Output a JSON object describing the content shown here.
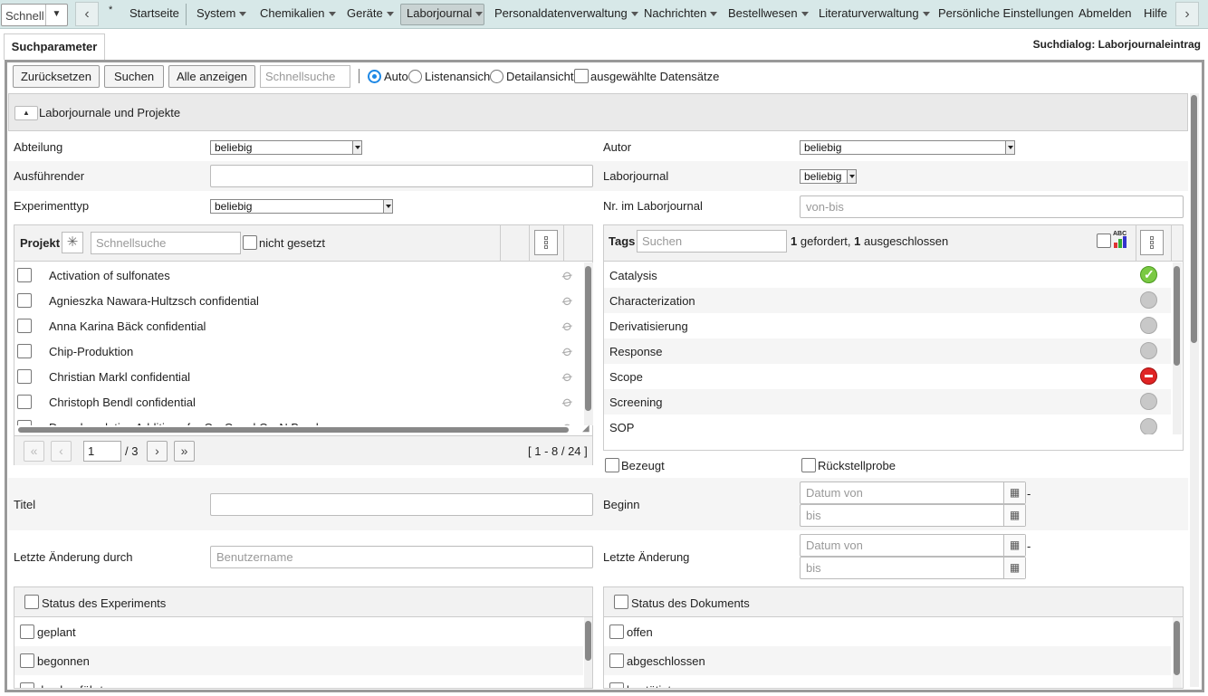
{
  "nav": {
    "quick_value": "Schnell",
    "items": [
      "*",
      "Startseite",
      "System",
      "Chemikalien",
      "Geräte",
      "Laborjournal",
      "Personaldatenverwaltung",
      "Nachrichten",
      "Bestellwesen",
      "Literaturverwaltung",
      "Persönliche Einstellungen",
      "Abmelden",
      "Hilfe"
    ],
    "active": "Laborjournal"
  },
  "tabs": {
    "active": "Suchparameter"
  },
  "dialog_title": "Suchdialog: Laborjournaleintrag",
  "toolbar": {
    "reset_label": "Zurücksetzen",
    "search_label": "Suchen",
    "show_all_label": "Alle anzeigen",
    "quick_search_placeholder": "Schnellsuche",
    "views": [
      "Auto",
      "Listenansicht",
      "Detailansicht"
    ],
    "selected_view": "Auto",
    "selected_records_label": "ausgewählte Datensätze"
  },
  "section": {
    "title": "Laborjournale und Projekte"
  },
  "form": {
    "abteilung_label": "Abteilung",
    "abteilung_value": "beliebig",
    "autor_label": "Autor",
    "autor_value": "beliebig",
    "ausfuehrender_label": "Ausführender",
    "laborjournal_label": "Laborjournal",
    "laborjournal_value": "beliebig",
    "experimenttyp_label": "Experimenttyp",
    "experimenttyp_value": "beliebig",
    "nr_label": "Nr. im Laborjournal",
    "nr_placeholder": "von-bis",
    "bezeugt_label": "Bezeugt",
    "rueckstellprobe_label": "Rückstellprobe",
    "titel_label": "Titel",
    "beginn_label": "Beginn",
    "date_from_placeholder": "Datum von",
    "date_to_placeholder": "bis",
    "date_dash": "-",
    "letzte_aenderung_durch_label": "Letzte Änderung durch",
    "username_placeholder": "Benutzername",
    "letzte_aenderung_label": "Letzte Änderung"
  },
  "projekt": {
    "title": "Projekt",
    "search_placeholder": "Schnellsuche",
    "not_set_label": "nicht gesetzt",
    "items": [
      "Activation of sulfonates",
      "Agnieszka Nawara-Hultzsch confidential",
      "Anna Karina Bäck confidential",
      "Chip-Produktion",
      "Christian Markl confidential",
      "Christoph Bendl confidential",
      "Decarboxylative Additions for C—C and C—N Bond..."
    ],
    "page": "1",
    "page_total": "/ 3",
    "range": "[ 1 - 8 / 24 ]"
  },
  "tags": {
    "title": "Tags",
    "search_placeholder": "Suchen",
    "required_count": "1",
    "required_text": "gefordert,",
    "excluded_count": "1",
    "excluded_text": "ausgeschlossen",
    "abc_label": "ABC",
    "items": [
      {
        "name": "Catalysis",
        "state": "required"
      },
      {
        "name": "Characterization",
        "state": "neutral"
      },
      {
        "name": "Derivatisierung",
        "state": "neutral"
      },
      {
        "name": "Response",
        "state": "neutral"
      },
      {
        "name": "Scope",
        "state": "excluded"
      },
      {
        "name": "Screening",
        "state": "neutral"
      },
      {
        "name": "SOP",
        "state": "neutral"
      }
    ]
  },
  "status_experiment": {
    "title": "Status des Experiments",
    "items": [
      "geplant",
      "begonnen",
      "durchgeführt"
    ]
  },
  "status_dokument": {
    "title": "Status des Dokuments",
    "items": [
      "offen",
      "abgeschlossen",
      "bestätigt"
    ]
  },
  "colors": {
    "accent": "#1e88e5",
    "nav_bg": "#d7e8e8",
    "required": "#7ac943",
    "excluded": "#e02424"
  }
}
